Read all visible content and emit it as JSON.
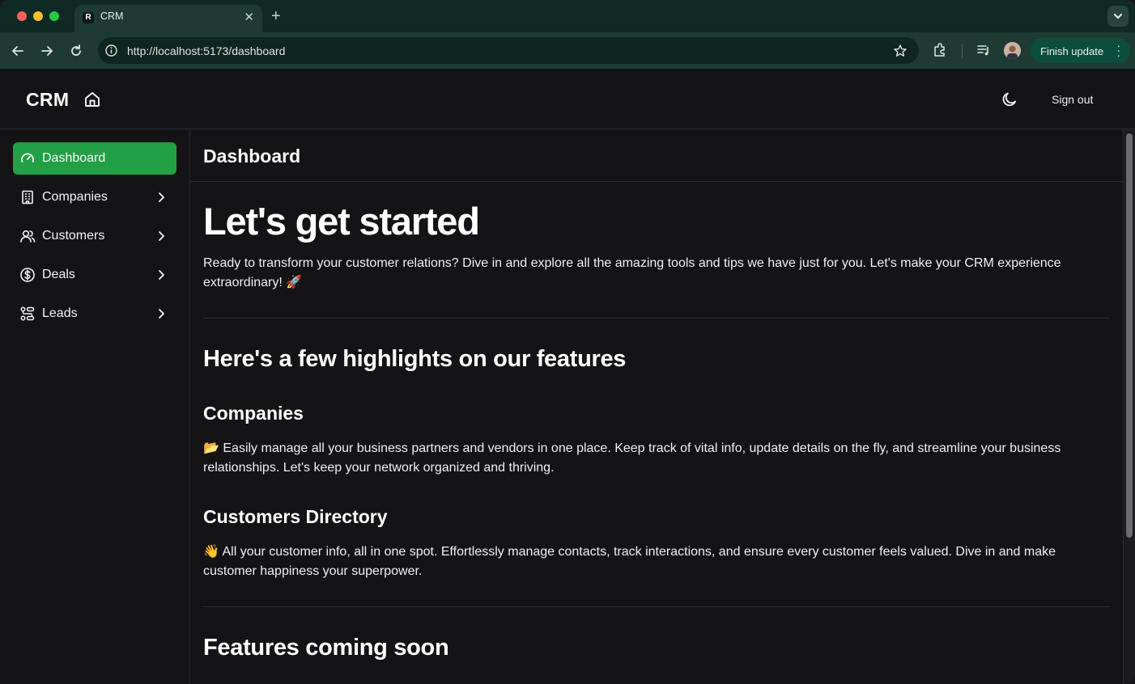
{
  "browser": {
    "tab_title": "CRM",
    "tab_favicon": "R",
    "url": "http://localhost:5173/dashboard",
    "finish_update_label": "Finish update"
  },
  "header": {
    "logo": "CRM",
    "sign_out_label": "Sign out"
  },
  "sidebar": {
    "items": [
      {
        "label": "Dashboard",
        "icon": "gauge-icon",
        "active": true
      },
      {
        "label": "Companies",
        "icon": "building-icon"
      },
      {
        "label": "Customers",
        "icon": "users-icon"
      },
      {
        "label": "Deals",
        "icon": "dollar-circle-icon"
      },
      {
        "label": "Leads",
        "icon": "workflow-icon"
      }
    ]
  },
  "main": {
    "page_title": "Dashboard",
    "hero_title": "Let's get started",
    "intro_text": "Ready to transform your customer relations? Dive in and explore all the amazing tools and tips we have just for you. Let's make your CRM experience extraordinary! 🚀",
    "highlights_heading": "Here's a few highlights on our features",
    "companies_heading": "Companies",
    "companies_text": "📂 Easily manage all your business partners and vendors in one place. Keep track of vital info, update details on the fly, and streamline your business relationships. Let's keep your network organized and thriving.",
    "customers_heading": "Customers Directory",
    "customers_text": "👋 All your customer info, all in one spot. Effortlessly manage contacts, track interactions, and ensure every customer feels valued. Dive in and make customer happiness your superpower.",
    "coming_soon_heading": "Features coming soon"
  },
  "colors": {
    "accent": "#22a045",
    "background": "#141416",
    "browser_frame": "#1d3b33"
  }
}
